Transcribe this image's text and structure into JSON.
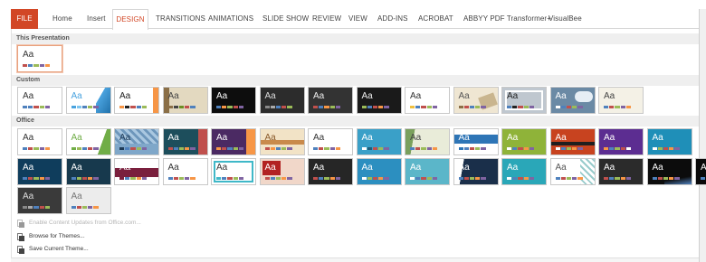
{
  "ribbon": {
    "tabs": [
      {
        "label": "FILE",
        "state": "file"
      },
      {
        "label": "Home",
        "state": "normal"
      },
      {
        "label": "Insert",
        "state": "normal"
      },
      {
        "label": "DESIGN",
        "state": "active"
      },
      {
        "label": "TRANSITIONS",
        "state": "normal"
      },
      {
        "label": "ANIMATIONS",
        "state": "normal"
      },
      {
        "label": "SLIDE SHOW",
        "state": "normal"
      },
      {
        "label": "REVIEW",
        "state": "normal"
      },
      {
        "label": "VIEW",
        "state": "normal"
      },
      {
        "label": "ADD-INS",
        "state": "normal"
      },
      {
        "label": "ACROBAT",
        "state": "normal"
      },
      {
        "label": "ABBYY PDF Transformer+",
        "state": "normal"
      },
      {
        "label": "VisualBee",
        "state": "normal"
      }
    ],
    "accent": "#d24726"
  },
  "gallery": {
    "sections": [
      {
        "title": "This Presentation"
      },
      {
        "title": "Custom"
      },
      {
        "title": "Office"
      }
    ],
    "this_presentation": [
      {
        "label": "Aa",
        "bg": "#ffffff",
        "fg": "#333333",
        "selected": true,
        "dots": [
          "#c0504d",
          "#4f81bd",
          "#9bbb59",
          "#8064a2",
          "#f79646"
        ]
      }
    ],
    "custom": [
      {
        "label": "Aa",
        "bg": "#ffffff",
        "fg": "#333333",
        "deco": "none",
        "dots": [
          "#4f81bd",
          "#4f81bd",
          "#c0504d",
          "#9bbb59",
          "#8064a2"
        ]
      },
      {
        "label": "Aa",
        "bg": "#ffffff",
        "fg": "#4aa3df",
        "deco": "wave-blue",
        "dots": [
          "#4aa3df",
          "#7fc6ef",
          "#4f81bd",
          "#9bbb59",
          "#8064a2"
        ]
      },
      {
        "label": "Aa",
        "bg": "#ffffff",
        "fg": "#222222",
        "deco": "stripe-right-orange",
        "dots": [
          "#f79646",
          "#222",
          "#c0504d",
          "#4f81bd",
          "#9bbb59"
        ]
      },
      {
        "label": "Aa",
        "bg": "#e3d9c0",
        "fg": "#444444",
        "deco": "paper",
        "dots": [
          "#8b6f47",
          "#444",
          "#6b8e23",
          "#c0504d",
          "#4f81bd"
        ]
      },
      {
        "label": "Aa",
        "bg": "#0d0d0d",
        "fg": "#ffffff",
        "deco": "dark",
        "dots": [
          "#4f81bd",
          "#f79646",
          "#9bbb59",
          "#c0504d",
          "#8064a2"
        ]
      },
      {
        "label": "Aa",
        "bg": "#2c2c2c",
        "fg": "#dddddd",
        "deco": "dark",
        "dots": [
          "#888",
          "#aaa",
          "#4f81bd",
          "#c0504d",
          "#9bbb59"
        ]
      },
      {
        "label": "Aa",
        "bg": "#333333",
        "fg": "#eeeeee",
        "deco": "dark",
        "dots": [
          "#c0504d",
          "#4f81bd",
          "#f79646",
          "#9bbb59",
          "#8064a2"
        ]
      },
      {
        "label": "Aa",
        "bg": "#1a1a1a",
        "fg": "#eeeeee",
        "deco": "dark",
        "dots": [
          "#9bbb59",
          "#4f81bd",
          "#c0504d",
          "#f79646",
          "#8064a2"
        ]
      },
      {
        "label": "Aa",
        "bg": "#ffffff",
        "fg": "#333333",
        "deco": "none",
        "dots": [
          "#f0c040",
          "#4f81bd",
          "#c0504d",
          "#9bbb59",
          "#8064a2"
        ]
      },
      {
        "label": "Aa",
        "bg": "#efe6d2",
        "fg": "#555555",
        "deco": "vintage",
        "dots": [
          "#8b6f47",
          "#c0504d",
          "#4f81bd",
          "#9bbb59",
          "#8064a2"
        ]
      },
      {
        "label": "Aa",
        "bg": "#bfc7cf",
        "fg": "#222222",
        "deco": "frame-grey",
        "dots": [
          "#4f81bd",
          "#222",
          "#c0504d",
          "#9bbb59",
          "#8064a2"
        ]
      },
      {
        "label": "Aa",
        "bg": "#6b8aa5",
        "fg": "#ffffff",
        "deco": "clouds",
        "dots": [
          "#fff",
          "#4f81bd",
          "#c0504d",
          "#9bbb59",
          "#8064a2"
        ]
      },
      {
        "label": "Aa",
        "bg": "#f4f1e6",
        "fg": "#444444",
        "deco": "none",
        "dots": [
          "#4f81bd",
          "#c0504d",
          "#9bbb59",
          "#8064a2",
          "#f79646"
        ]
      }
    ],
    "office_row1": [
      {
        "label": "Aa",
        "bg": "#ffffff",
        "fg": "#333333",
        "deco": "none",
        "dots": [
          "#4f81bd",
          "#c0504d",
          "#9bbb59",
          "#8064a2",
          "#f79646"
        ]
      },
      {
        "label": "Aa",
        "bg": "#ffffff",
        "fg": "#70ad47",
        "deco": "facet-green",
        "dots": [
          "#70ad47",
          "#9bbb59",
          "#4f81bd",
          "#c0504d",
          "#8064a2"
        ]
      },
      {
        "label": "Aa",
        "bg": "#7fa7c9",
        "fg": "#1f3b57",
        "deco": "pattern-blue",
        "dots": [
          "#1f3b57",
          "#4f81bd",
          "#c0504d",
          "#9bbb59",
          "#8064a2"
        ]
      },
      {
        "label": "Aa",
        "bg": "#1d4e5c",
        "fg": "#ffffff",
        "deco": "ion",
        "dots": [
          "#c0504d",
          "#4f81bd",
          "#9bbb59",
          "#f79646",
          "#8064a2"
        ]
      },
      {
        "label": "Aa",
        "bg": "#4b2a63",
        "fg": "#ffffff",
        "deco": "ion-purple",
        "dots": [
          "#f79646",
          "#c0504d",
          "#4f81bd",
          "#9bbb59",
          "#8064a2"
        ]
      },
      {
        "label": "Aa",
        "bg": "#f2e3c6",
        "fg": "#8a5a2b",
        "deco": "organic",
        "dots": [
          "#c0504d",
          "#f79646",
          "#4f81bd",
          "#9bbb59",
          "#8064a2"
        ]
      },
      {
        "label": "Aa",
        "bg": "#ffffff",
        "fg": "#333333",
        "deco": "none",
        "dots": [
          "#4f81bd",
          "#c0504d",
          "#9bbb59",
          "#8064a2",
          "#f79646"
        ]
      },
      {
        "label": "Aa",
        "bg": "#3aa0c8",
        "fg": "#ffffff",
        "deco": "none",
        "dots": [
          "#fff",
          "#1f5f7a",
          "#c0504d",
          "#9bbb59",
          "#8064a2"
        ]
      },
      {
        "label": "Aa",
        "bg": "#e9ecd9",
        "fg": "#444444",
        "deco": "slice",
        "dots": [
          "#4f81bd",
          "#c0504d",
          "#9bbb59",
          "#8064a2",
          "#f79646"
        ]
      },
      {
        "label": "Aa",
        "bg": "#ffffff",
        "fg": "#ffffff",
        "deco": "band-blue",
        "dots": [
          "#2e75b6",
          "#4f81bd",
          "#c0504d",
          "#9bbb59",
          "#8064a2"
        ]
      },
      {
        "label": "Aa",
        "bg": "#8fb339",
        "fg": "#ffffff",
        "deco": "none",
        "dots": [
          "#fff",
          "#4f81bd",
          "#c0504d",
          "#f79646",
          "#8064a2"
        ]
      },
      {
        "label": "Aa",
        "bg": "#c8431f",
        "fg": "#ffffff",
        "deco": "stripe-dark",
        "dots": [
          "#fff",
          "#4f81bd",
          "#9bbb59",
          "#f79646",
          "#8064a2"
        ]
      },
      {
        "label": "Aa",
        "bg": "#5c2d91",
        "fg": "#ffffff",
        "deco": "none",
        "dots": [
          "#f79646",
          "#4f81bd",
          "#9bbb59",
          "#c0504d",
          "#fff"
        ]
      },
      {
        "label": "Aa",
        "bg": "#1f8fb8",
        "fg": "#ffffff",
        "deco": "none",
        "dots": [
          "#fff",
          "#9bbb59",
          "#c0504d",
          "#f79646",
          "#8064a2"
        ]
      }
    ],
    "office_row2": [
      {
        "label": "Aa",
        "bg": "#0f3d5c",
        "fg": "#ffffff",
        "deco": "none",
        "dots": [
          "#4f81bd",
          "#c0504d",
          "#9bbb59",
          "#f79646",
          "#8064a2"
        ]
      },
      {
        "label": "Aa",
        "bg": "#17394d",
        "fg": "#ffffff",
        "deco": "none",
        "dots": [
          "#4f81bd",
          "#9bbb59",
          "#c0504d",
          "#f79646",
          "#8064a2"
        ]
      },
      {
        "label": "Aa",
        "bg": "#ffffff",
        "fg": "#ffffff",
        "deco": "maroon-band",
        "dots": [
          "#7a1f3d",
          "#4f81bd",
          "#9bbb59",
          "#f79646",
          "#8064a2"
        ]
      },
      {
        "label": "Aa",
        "bg": "#ffffff",
        "fg": "#333333",
        "deco": "none",
        "dots": [
          "#4f81bd",
          "#c0504d",
          "#9bbb59",
          "#8064a2",
          "#f79646"
        ]
      },
      {
        "label": "Aa",
        "bg": "#ffffff",
        "fg": "#333333",
        "deco": "frame-teal",
        "dots": [
          "#3fb8c8",
          "#4f81bd",
          "#c0504d",
          "#9bbb59",
          "#8064a2"
        ]
      },
      {
        "label": "Aa",
        "bg": "#f1d7c9",
        "fg": "#ffffff",
        "deco": "red-block",
        "dots": [
          "#c0504d",
          "#4f81bd",
          "#9bbb59",
          "#f79646",
          "#8064a2"
        ]
      },
      {
        "label": "Aa",
        "bg": "#262626",
        "fg": "#ffffff",
        "deco": "none",
        "dots": [
          "#c0504d",
          "#4f81bd",
          "#9bbb59",
          "#f79646",
          "#8064a2"
        ]
      },
      {
        "label": "Aa",
        "bg": "#2c8fc0",
        "fg": "#ffffff",
        "deco": "none",
        "dots": [
          "#fff",
          "#9bbb59",
          "#c0504d",
          "#f79646",
          "#8064a2"
        ]
      },
      {
        "label": "Aa",
        "bg": "#5bb6c9",
        "fg": "#ffffff",
        "deco": "none",
        "dots": [
          "#fff",
          "#4f81bd",
          "#c0504d",
          "#9bbb59",
          "#8064a2"
        ]
      },
      {
        "label": "Aa",
        "bg": "#1a2f4a",
        "fg": "#ffffff",
        "deco": "slice-dark",
        "dots": [
          "#4f81bd",
          "#c0504d",
          "#9bbb59",
          "#f79646",
          "#8064a2"
        ]
      },
      {
        "label": "Aa",
        "bg": "#2aa7b8",
        "fg": "#ffffff",
        "deco": "none",
        "dots": [
          "#fff",
          "#4f81bd",
          "#c0504d",
          "#f79646",
          "#8064a2"
        ]
      },
      {
        "label": "Aa",
        "bg": "#ffffff",
        "fg": "#555555",
        "deco": "lattice",
        "dots": [
          "#4f81bd",
          "#c0504d",
          "#9bbb59",
          "#8064a2",
          "#f79646"
        ]
      },
      {
        "label": "Aa",
        "bg": "#2b2b2b",
        "fg": "#ffffff",
        "deco": "none",
        "dots": [
          "#c0504d",
          "#4f81bd",
          "#9bbb59",
          "#f79646",
          "#8064a2"
        ]
      },
      {
        "label": "Aa",
        "bg": "#0c0c0c",
        "fg": "#ffffff",
        "deco": "wave-dark",
        "dots": [
          "#4f81bd",
          "#c0504d",
          "#9bbb59",
          "#f79646",
          "#8064a2"
        ]
      },
      {
        "label": "Aa",
        "bg": "#0a0a0a",
        "fg": "#ffffff",
        "deco": "swirl-blue",
        "dots": [
          "#4f81bd",
          "#c0504d",
          "#9bbb59",
          "#f79646",
          "#8064a2"
        ]
      }
    ],
    "office_row3": [
      {
        "label": "Aa",
        "bg": "#3a3a3a",
        "fg": "#dddddd",
        "deco": "none",
        "dots": [
          "#888",
          "#aaa",
          "#4f81bd",
          "#c0504d",
          "#9bbb59"
        ]
      },
      {
        "label": "Aa",
        "bg": "#ececec",
        "fg": "#777777",
        "deco": "none",
        "dots": [
          "#4f81bd",
          "#c0504d",
          "#9bbb59",
          "#8064a2",
          "#f79646"
        ]
      }
    ]
  },
  "commands": [
    {
      "label": "Enable Content Updates from Office.com...",
      "enabled": false,
      "icon": "theme-update-icon"
    },
    {
      "label": "Browse for Themes...",
      "enabled": true,
      "icon": "browse-themes-icon"
    },
    {
      "label": "Save Current Theme...",
      "enabled": true,
      "icon": "save-theme-icon"
    }
  ]
}
